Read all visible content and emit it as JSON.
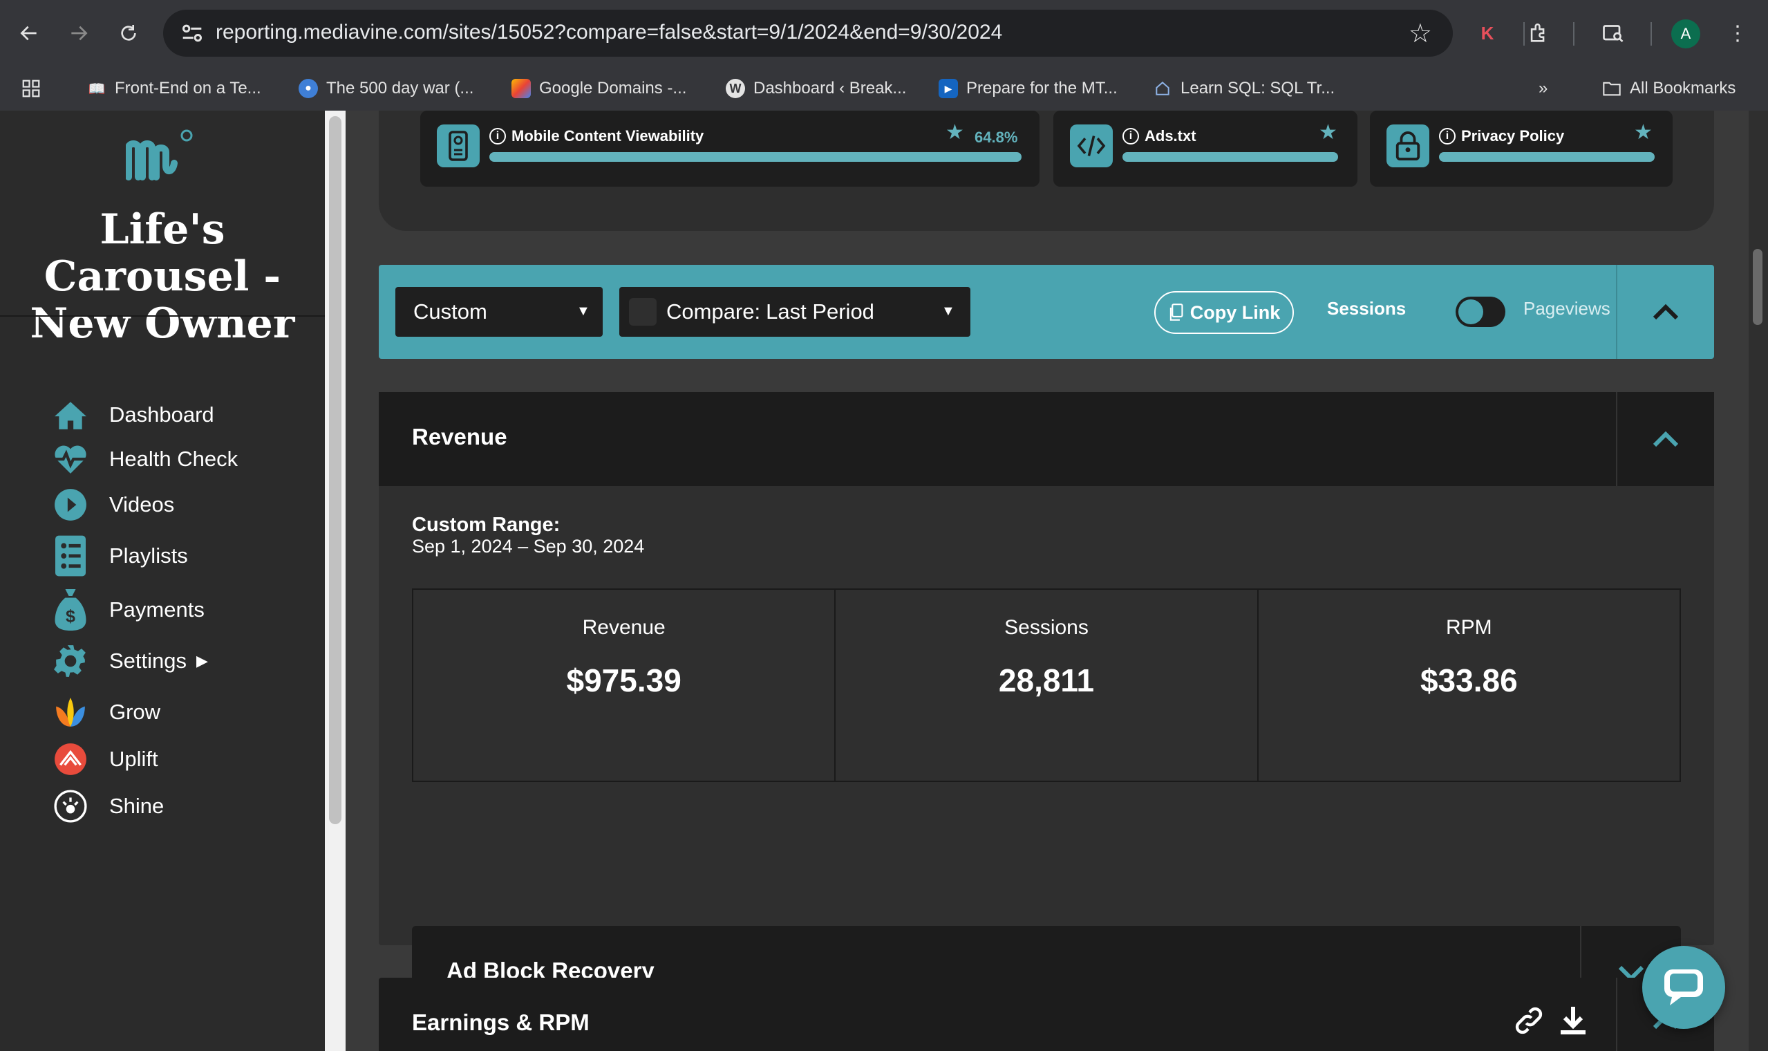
{
  "browser": {
    "url": "reporting.mediavine.com/sites/15052?compare=false&start=9/1/2024&end=9/30/2024",
    "profile_initial": "A",
    "extension_initial": "K",
    "bookmarks": [
      {
        "label": "Front-End on a Te...",
        "icon": "book-icon"
      },
      {
        "label": "The 500 day war (...",
        "icon": "globe-icon"
      },
      {
        "label": "Google Domains -...",
        "icon": "google-domains-icon"
      },
      {
        "label": "Dashboard ‹ Break...",
        "icon": "wordpress-icon"
      },
      {
        "label": "Prepare for the MT...",
        "icon": "video-icon"
      },
      {
        "label": "Learn SQL: SQL Tr...",
        "icon": "house-icon"
      }
    ],
    "all_bookmarks_label": "All Bookmarks"
  },
  "sidebar": {
    "site_title": "Life's Carousel - New Owner",
    "items": [
      {
        "label": "Dashboard",
        "icon": "home-icon"
      },
      {
        "label": "Health Check",
        "icon": "heartbeat-icon"
      },
      {
        "label": "Videos",
        "icon": "play-icon"
      },
      {
        "label": "Playlists",
        "icon": "list-icon"
      },
      {
        "label": "Payments",
        "icon": "money-bag-icon"
      },
      {
        "label": "Settings",
        "icon": "gear-icon"
      },
      {
        "label": "Grow",
        "icon": "grow-icon"
      },
      {
        "label": "Uplift",
        "icon": "uplift-icon"
      },
      {
        "label": "Shine",
        "icon": "shine-icon"
      }
    ]
  },
  "health_checks": [
    {
      "label": "Mobile Content Viewability",
      "percent": "64.8%",
      "icon": "mobile-icon"
    },
    {
      "label": "Ads.txt",
      "icon": "code-icon"
    },
    {
      "label": "Privacy Policy",
      "icon": "lock-icon"
    }
  ],
  "filters": {
    "range_select": "Custom",
    "compare_prefix": "Compare:",
    "compare_select": "Last Period",
    "copy_link": "Copy Link",
    "toggle_left": "Sessions",
    "toggle_right": "Pageviews"
  },
  "revenue": {
    "title": "Revenue",
    "range_label": "Custom Range:",
    "range_value": "Sep 1, 2024 – Sep 30, 2024",
    "stats": [
      {
        "label": "Revenue",
        "value": "$975.39"
      },
      {
        "label": "Sessions",
        "value": "28,811"
      },
      {
        "label": "RPM",
        "value": "$33.86"
      }
    ],
    "ad_block_title": "Ad Block Recovery"
  },
  "earnings": {
    "title": "Earnings & RPM"
  },
  "colors": {
    "accent": "#4aa4b0",
    "panel_dark": "#1c1c1c",
    "sidebar": "#2b2b2b"
  }
}
